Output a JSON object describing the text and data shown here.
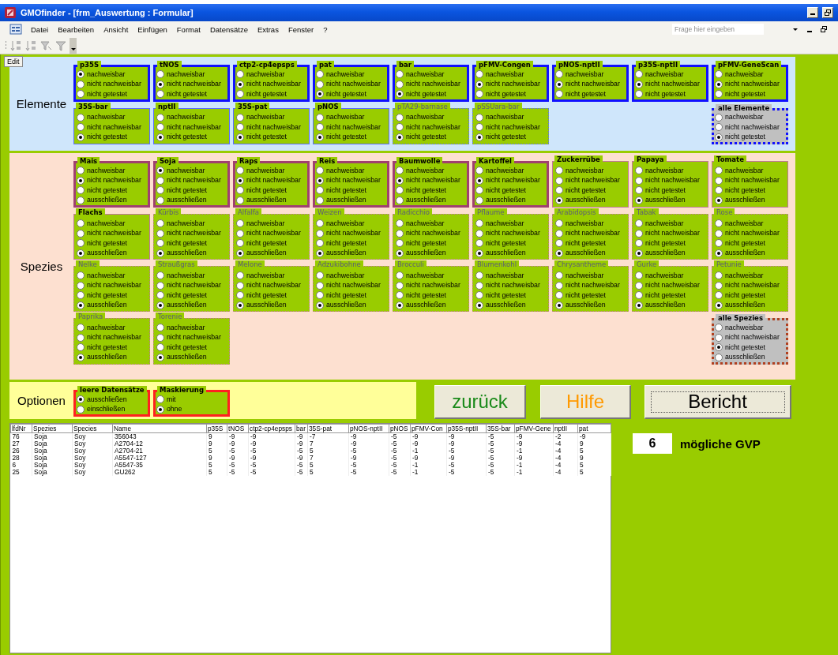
{
  "window": {
    "title": "GMOfinder - [frm_Auswertung : Formular]"
  },
  "menu": [
    "Datei",
    "Bearbeiten",
    "Ansicht",
    "Einfügen",
    "Format",
    "Datensätze",
    "Extras",
    "Fenster",
    "?"
  ],
  "help_field": {
    "placeholder": "Frage hier eingeben"
  },
  "edit_tab": "Edit",
  "sections": [
    {
      "kind": "elements",
      "label": "Elemente",
      "groups": [
        {
          "title": "p35S",
          "highlighted": true,
          "disabled": false,
          "options": [
            {
              "label": "nachweisbar",
              "selected": true
            },
            {
              "label": "nicht nachweisbar",
              "selected": false
            },
            {
              "label": "nicht getestet",
              "selected": false
            }
          ]
        },
        {
          "title": "tNOS",
          "highlighted": true,
          "disabled": false,
          "options": [
            {
              "label": "nachweisbar",
              "selected": false
            },
            {
              "label": "nicht nachweisbar",
              "selected": true
            },
            {
              "label": "nicht getestet",
              "selected": false
            }
          ]
        },
        {
          "title": "ctp2-cp4epsps",
          "highlighted": true,
          "disabled": false,
          "options": [
            {
              "label": "nachweisbar",
              "selected": false
            },
            {
              "label": "nicht nachweisbar",
              "selected": true
            },
            {
              "label": "nicht getestet",
              "selected": false
            }
          ]
        },
        {
          "title": "pat",
          "highlighted": true,
          "disabled": false,
          "options": [
            {
              "label": "nachweisbar",
              "selected": false
            },
            {
              "label": "nicht nachweisbar",
              "selected": false
            },
            {
              "label": "nicht getestet",
              "selected": true
            }
          ]
        },
        {
          "title": "bar",
          "highlighted": true,
          "disabled": false,
          "options": [
            {
              "label": "nachweisbar",
              "selected": false
            },
            {
              "label": "nicht nachweisbar",
              "selected": false
            },
            {
              "label": "nicht getestet",
              "selected": true
            }
          ]
        },
        {
          "title": "pFMV-Congen",
          "highlighted": true,
          "disabled": false,
          "options": [
            {
              "label": "nachweisbar",
              "selected": false
            },
            {
              "label": "nicht nachweisbar",
              "selected": true
            },
            {
              "label": "nicht getestet",
              "selected": false
            }
          ]
        },
        {
          "title": "pNOS-nptII",
          "highlighted": true,
          "disabled": false,
          "options": [
            {
              "label": "nachweisbar",
              "selected": false
            },
            {
              "label": "nicht nachweisbar",
              "selected": true
            },
            {
              "label": "nicht getestet",
              "selected": false
            }
          ]
        },
        {
          "title": "p35S-nptII",
          "highlighted": true,
          "disabled": false,
          "options": [
            {
              "label": "nachweisbar",
              "selected": false
            },
            {
              "label": "nicht nachweisbar",
              "selected": true
            },
            {
              "label": "nicht getestet",
              "selected": false
            }
          ]
        },
        {
          "title": "pFMV-GeneScan",
          "highlighted": true,
          "disabled": false,
          "options": [
            {
              "label": "nachweisbar",
              "selected": false
            },
            {
              "label": "nicht nachweisbar",
              "selected": true
            },
            {
              "label": "nicht getestet",
              "selected": false
            }
          ]
        },
        {
          "title": "35S-bar",
          "highlighted": false,
          "disabled": false,
          "options": [
            {
              "label": "nachweisbar",
              "selected": false
            },
            {
              "label": "nicht nachweisbar",
              "selected": false
            },
            {
              "label": "nicht getestet",
              "selected": true
            }
          ]
        },
        {
          "title": "nptII",
          "highlighted": false,
          "disabled": false,
          "options": [
            {
              "label": "nachweisbar",
              "selected": false
            },
            {
              "label": "nicht nachweisbar",
              "selected": false
            },
            {
              "label": "nicht getestet",
              "selected": true
            }
          ]
        },
        {
          "title": "35S-pat",
          "highlighted": false,
          "disabled": false,
          "options": [
            {
              "label": "nachweisbar",
              "selected": false
            },
            {
              "label": "nicht nachweisbar",
              "selected": false
            },
            {
              "label": "nicht getestet",
              "selected": true
            }
          ]
        },
        {
          "title": "pNOS",
          "highlighted": false,
          "disabled": false,
          "options": [
            {
              "label": "nachweisbar",
              "selected": false
            },
            {
              "label": "nicht nachweisbar",
              "selected": false
            },
            {
              "label": "nicht getestet",
              "selected": true
            }
          ]
        },
        {
          "title": "pTA29-barnase",
          "highlighted": false,
          "disabled": true,
          "options": [
            {
              "label": "nachweisbar",
              "selected": false
            },
            {
              "label": "nicht nachweisbar",
              "selected": false
            },
            {
              "label": "nicht getestet",
              "selected": true
            }
          ]
        },
        {
          "title": "pSSUara-bar",
          "highlighted": false,
          "disabled": true,
          "options": [
            {
              "label": "nachweisbar",
              "selected": false
            },
            {
              "label": "nicht nachweisbar",
              "selected": false
            },
            {
              "label": "nicht getestet",
              "selected": true
            }
          ]
        }
      ],
      "all_group": {
        "title": "alle Elemente",
        "options": [
          {
            "label": "nachweisbar",
            "selected": false
          },
          {
            "label": "nicht nachweisbar",
            "selected": false
          },
          {
            "label": "nicht getestet",
            "selected": true
          }
        ]
      }
    },
    {
      "kind": "species",
      "label": "Spezies",
      "groups": [
        {
          "title": "Mais",
          "highlighted": true,
          "disabled": false,
          "options": [
            {
              "label": "nachweisbar",
              "selected": false
            },
            {
              "label": "nicht nachweisbar",
              "selected": true
            },
            {
              "label": "nicht getestet",
              "selected": false
            },
            {
              "label": "ausschließen",
              "selected": false
            }
          ]
        },
        {
          "title": "Soja",
          "highlighted": true,
          "disabled": false,
          "options": [
            {
              "label": "nachweisbar",
              "selected": true
            },
            {
              "label": "nicht nachweisbar",
              "selected": false
            },
            {
              "label": "nicht getestet",
              "selected": false
            },
            {
              "label": "ausschließen",
              "selected": false
            }
          ]
        },
        {
          "title": "Raps",
          "highlighted": true,
          "disabled": false,
          "options": [
            {
              "label": "nachweisbar",
              "selected": false
            },
            {
              "label": "nicht nachweisbar",
              "selected": true
            },
            {
              "label": "nicht getestet",
              "selected": false
            },
            {
              "label": "ausschließen",
              "selected": false
            }
          ]
        },
        {
          "title": "Reis",
          "highlighted": true,
          "disabled": false,
          "options": [
            {
              "label": "nachweisbar",
              "selected": false
            },
            {
              "label": "nicht nachweisbar",
              "selected": true
            },
            {
              "label": "nicht getestet",
              "selected": false
            },
            {
              "label": "ausschließen",
              "selected": false
            }
          ]
        },
        {
          "title": "Baumwolle",
          "highlighted": true,
          "disabled": false,
          "options": [
            {
              "label": "nachweisbar",
              "selected": false
            },
            {
              "label": "nicht nachweisbar",
              "selected": true
            },
            {
              "label": "nicht getestet",
              "selected": false
            },
            {
              "label": "ausschließen",
              "selected": false
            }
          ]
        },
        {
          "title": "Kartoffel",
          "highlighted": true,
          "disabled": false,
          "options": [
            {
              "label": "nachweisbar",
              "selected": false
            },
            {
              "label": "nicht nachweisbar",
              "selected": true
            },
            {
              "label": "nicht getestet",
              "selected": false
            },
            {
              "label": "ausschließen",
              "selected": false
            }
          ]
        },
        {
          "title": "Zuckerrübe",
          "highlighted": false,
          "disabled": false,
          "options": [
            {
              "label": "nachweisbar",
              "selected": false
            },
            {
              "label": "nicht nachweisbar",
              "selected": false
            },
            {
              "label": "nicht getestet",
              "selected": false
            },
            {
              "label": "ausschließen",
              "selected": true
            }
          ]
        },
        {
          "title": "Papaya",
          "highlighted": false,
          "disabled": false,
          "options": [
            {
              "label": "nachweisbar",
              "selected": false
            },
            {
              "label": "nicht nachweisbar",
              "selected": false
            },
            {
              "label": "nicht getestet",
              "selected": false
            },
            {
              "label": "ausschließen",
              "selected": true
            }
          ]
        },
        {
          "title": "Tomate",
          "highlighted": false,
          "disabled": false,
          "options": [
            {
              "label": "nachweisbar",
              "selected": false
            },
            {
              "label": "nicht nachweisbar",
              "selected": false
            },
            {
              "label": "nicht getestet",
              "selected": false
            },
            {
              "label": "ausschließen",
              "selected": true
            }
          ]
        },
        {
          "title": "Flachs",
          "highlighted": false,
          "disabled": false,
          "options": [
            {
              "label": "nachweisbar",
              "selected": false
            },
            {
              "label": "nicht nachweisbar",
              "selected": false
            },
            {
              "label": "nicht getestet",
              "selected": false
            },
            {
              "label": "ausschließen",
              "selected": true
            }
          ]
        },
        {
          "title": "Kürbis",
          "highlighted": false,
          "disabled": true,
          "options": [
            {
              "label": "nachweisbar",
              "selected": false
            },
            {
              "label": "nicht nachweisbar",
              "selected": false
            },
            {
              "label": "nicht getestet",
              "selected": false
            },
            {
              "label": "ausschließen",
              "selected": true
            }
          ]
        },
        {
          "title": "Alfalfa",
          "highlighted": false,
          "disabled": true,
          "options": [
            {
              "label": "nachweisbar",
              "selected": false
            },
            {
              "label": "nicht nachweisbar",
              "selected": false
            },
            {
              "label": "nicht getestet",
              "selected": false
            },
            {
              "label": "ausschließen",
              "selected": true
            }
          ]
        },
        {
          "title": "Weizen",
          "highlighted": false,
          "disabled": true,
          "options": [
            {
              "label": "nachweisbar",
              "selected": false
            },
            {
              "label": "nicht nachweisbar",
              "selected": false
            },
            {
              "label": "nicht getestet",
              "selected": false
            },
            {
              "label": "ausschließen",
              "selected": true
            }
          ]
        },
        {
          "title": "Radicchio",
          "highlighted": false,
          "disabled": true,
          "options": [
            {
              "label": "nachweisbar",
              "selected": false
            },
            {
              "label": "nicht nachweisbar",
              "selected": false
            },
            {
              "label": "nicht getestet",
              "selected": false
            },
            {
              "label": "ausschließen",
              "selected": true
            }
          ]
        },
        {
          "title": "Pflaume",
          "highlighted": false,
          "disabled": true,
          "options": [
            {
              "label": "nachweisbar",
              "selected": false
            },
            {
              "label": "nicht nachweisbar",
              "selected": false
            },
            {
              "label": "nicht getestet",
              "selected": false
            },
            {
              "label": "ausschließen",
              "selected": true
            }
          ]
        },
        {
          "title": "Arabidopsis",
          "highlighted": false,
          "disabled": true,
          "options": [
            {
              "label": "nachweisbar",
              "selected": false
            },
            {
              "label": "nicht nachweisbar",
              "selected": false
            },
            {
              "label": "nicht getestet",
              "selected": false
            },
            {
              "label": "ausschließen",
              "selected": true
            }
          ]
        },
        {
          "title": "Tabak",
          "highlighted": false,
          "disabled": true,
          "options": [
            {
              "label": "nachweisbar",
              "selected": false
            },
            {
              "label": "nicht nachweisbar",
              "selected": false
            },
            {
              "label": "nicht getestet",
              "selected": false
            },
            {
              "label": "ausschließen",
              "selected": true
            }
          ]
        },
        {
          "title": "Rose",
          "highlighted": false,
          "disabled": true,
          "options": [
            {
              "label": "nachweisbar",
              "selected": false
            },
            {
              "label": "nicht nachweisbar",
              "selected": false
            },
            {
              "label": "nicht getestet",
              "selected": false
            },
            {
              "label": "ausschließen",
              "selected": true
            }
          ]
        },
        {
          "title": "Nelke",
          "highlighted": false,
          "disabled": true,
          "options": [
            {
              "label": "nachweisbar",
              "selected": false
            },
            {
              "label": "nicht nachweisbar",
              "selected": false
            },
            {
              "label": "nicht getestet",
              "selected": false
            },
            {
              "label": "ausschließen",
              "selected": true
            }
          ]
        },
        {
          "title": "Straußgras",
          "highlighted": false,
          "disabled": true,
          "options": [
            {
              "label": "nachweisbar",
              "selected": false
            },
            {
              "label": "nicht nachweisbar",
              "selected": false
            },
            {
              "label": "nicht getestet",
              "selected": false
            },
            {
              "label": "ausschließen",
              "selected": true
            }
          ]
        },
        {
          "title": "Melone",
          "highlighted": false,
          "disabled": true,
          "options": [
            {
              "label": "nachweisbar",
              "selected": false
            },
            {
              "label": "nicht nachweisbar",
              "selected": false
            },
            {
              "label": "nicht getestet",
              "selected": false
            },
            {
              "label": "ausschließen",
              "selected": true
            }
          ]
        },
        {
          "title": "Adzukibohne",
          "highlighted": false,
          "disabled": true,
          "options": [
            {
              "label": "nachweisbar",
              "selected": false
            },
            {
              "label": "nicht nachweisbar",
              "selected": false
            },
            {
              "label": "nicht getestet",
              "selected": false
            },
            {
              "label": "ausschließen",
              "selected": true
            }
          ]
        },
        {
          "title": "Brocculi",
          "highlighted": false,
          "disabled": true,
          "options": [
            {
              "label": "nachweisbar",
              "selected": false
            },
            {
              "label": "nicht nachweisbar",
              "selected": false
            },
            {
              "label": "nicht getestet",
              "selected": false
            },
            {
              "label": "ausschließen",
              "selected": true
            }
          ]
        },
        {
          "title": "Blumenkohl",
          "highlighted": false,
          "disabled": true,
          "options": [
            {
              "label": "nachweisbar",
              "selected": false
            },
            {
              "label": "nicht nachweisbar",
              "selected": false
            },
            {
              "label": "nicht getestet",
              "selected": false
            },
            {
              "label": "ausschließen",
              "selected": true
            }
          ]
        },
        {
          "title": "Chrysantheme",
          "highlighted": false,
          "disabled": true,
          "options": [
            {
              "label": "nachweisbar",
              "selected": false
            },
            {
              "label": "nicht nachweisbar",
              "selected": false
            },
            {
              "label": "nicht getestet",
              "selected": false
            },
            {
              "label": "ausschließen",
              "selected": true
            }
          ]
        },
        {
          "title": "Gurke",
          "highlighted": false,
          "disabled": true,
          "options": [
            {
              "label": "nachweisbar",
              "selected": false
            },
            {
              "label": "nicht nachweisbar",
              "selected": false
            },
            {
              "label": "nicht getestet",
              "selected": false
            },
            {
              "label": "ausschließen",
              "selected": true
            }
          ]
        },
        {
          "title": "Petunie",
          "highlighted": false,
          "disabled": true,
          "options": [
            {
              "label": "nachweisbar",
              "selected": false
            },
            {
              "label": "nicht nachweisbar",
              "selected": false
            },
            {
              "label": "nicht getestet",
              "selected": false
            },
            {
              "label": "ausschließen",
              "selected": true
            }
          ]
        },
        {
          "title": "Paprika",
          "highlighted": false,
          "disabled": true,
          "options": [
            {
              "label": "nachweisbar",
              "selected": false
            },
            {
              "label": "nicht nachweisbar",
              "selected": false
            },
            {
              "label": "nicht getestet",
              "selected": false
            },
            {
              "label": "ausschließen",
              "selected": true
            }
          ]
        },
        {
          "title": "Torenie",
          "highlighted": false,
          "disabled": true,
          "options": [
            {
              "label": "nachweisbar",
              "selected": false
            },
            {
              "label": "nicht nachweisbar",
              "selected": false
            },
            {
              "label": "nicht getestet",
              "selected": false
            },
            {
              "label": "ausschließen",
              "selected": true
            }
          ]
        }
      ],
      "all_group": {
        "title": "alle Spezies",
        "options": [
          {
            "label": "nachweisbar",
            "selected": false
          },
          {
            "label": "nicht nachweisbar",
            "selected": false
          },
          {
            "label": "nicht getestet",
            "selected": true
          },
          {
            "label": "ausschließen",
            "selected": false
          }
        ]
      }
    },
    {
      "kind": "options",
      "label": "Optionen",
      "groups": [
        {
          "title": "leere Datensätze",
          "highlighted": true,
          "disabled": false,
          "options": [
            {
              "label": "ausschließen",
              "selected": true
            },
            {
              "label": "einschließen",
              "selected": false
            }
          ]
        },
        {
          "title": "Maskierung",
          "highlighted": true,
          "disabled": false,
          "options": [
            {
              "label": "mit",
              "selected": false
            },
            {
              "label": "ohne",
              "selected": true
            }
          ]
        }
      ]
    }
  ],
  "buttons": [
    {
      "label": "zurück",
      "kind": "back",
      "color": "#1a8a1a",
      "focused": false
    },
    {
      "label": "Hilfe",
      "kind": "help",
      "color": "#ff9900",
      "focused": false
    },
    {
      "label": "Bericht",
      "kind": "report",
      "color": "#000000",
      "focused": true
    }
  ],
  "table": {
    "columns": [
      "lfdNr",
      "Spezies",
      "Species",
      "Name",
      "p35S",
      "tNOS",
      "ctp2-cp4epsps",
      "bar",
      "35S-pat",
      "pNOS-nptII",
      "pNOS",
      "pFMV-Con",
      "p35S-nptII",
      "35S-bar",
      "pFMV-Gene",
      "nptII",
      "pat"
    ],
    "rows": [
      [
        "76",
        "Soja",
        "Soy",
        "356043",
        "9",
        "-9",
        "-9",
        "-9",
        "-7",
        "-9",
        "-5",
        "-9",
        "-9",
        "-5",
        "-9",
        "-2",
        "-9"
      ],
      [
        "27",
        "Soja",
        "Soy",
        "A2704-12",
        "9",
        "-9",
        "-9",
        "-9",
        "7",
        "-9",
        "-5",
        "-9",
        "-9",
        "-5",
        "-9",
        "-4",
        "9"
      ],
      [
        "26",
        "Soja",
        "Soy",
        "A2704-21",
        "5",
        "-5",
        "-5",
        "-5",
        "5",
        "-5",
        "-5",
        "-1",
        "-5",
        "-5",
        "-1",
        "-4",
        "5"
      ],
      [
        "28",
        "Soja",
        "Soy",
        "A5547-127",
        "9",
        "-9",
        "-9",
        "-9",
        "7",
        "-9",
        "-5",
        "-9",
        "-9",
        "-5",
        "-9",
        "-4",
        "9"
      ],
      [
        "6",
        "Soja",
        "Soy",
        "A5547-35",
        "5",
        "-5",
        "-5",
        "-5",
        "5",
        "-5",
        "-5",
        "-1",
        "-5",
        "-5",
        "-1",
        "-4",
        "5"
      ],
      [
        "25",
        "Soja",
        "Soy",
        "GU262",
        "5",
        "-5",
        "-5",
        "-5",
        "5",
        "-5",
        "-5",
        "-1",
        "-5",
        "-5",
        "-1",
        "-4",
        "5"
      ]
    ]
  },
  "result": {
    "count": "6",
    "label": "mögliche GVP"
  }
}
